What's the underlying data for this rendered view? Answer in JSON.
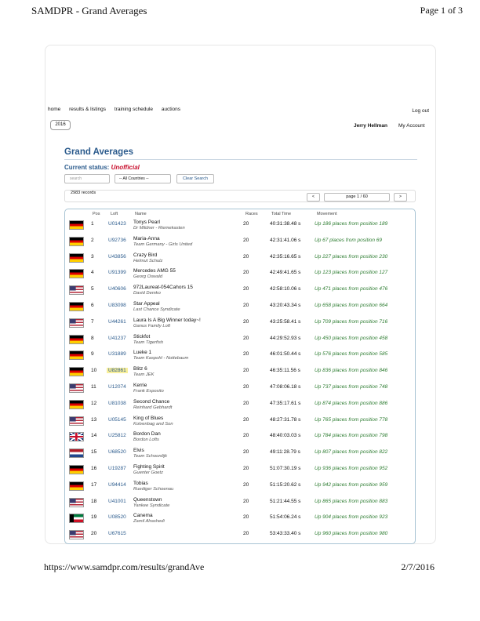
{
  "print": {
    "title": "SAMDPR - Grand Averages",
    "page": "Page 1 of 3",
    "url": "https://www.samdpr.com/results/grandAve",
    "date": "2/7/2016"
  },
  "nav": {
    "items": [
      "home",
      "results & listings",
      "training schedule",
      "auctions"
    ],
    "logout": "Log out"
  },
  "season": "2016",
  "user": {
    "name": "Jerry Hellman",
    "my_account": "My Account"
  },
  "page_title": "Grand Averages",
  "status": {
    "label": "Current status:",
    "value": "Unofficial"
  },
  "search": {
    "placeholder": "search"
  },
  "country_filter": {
    "selected": "-- All Countries --"
  },
  "clear_button": "Clear Search",
  "records": "2983 records",
  "pager": {
    "prev": "<",
    "page": "page 1 / 60",
    "next": ">"
  },
  "columns": [
    "Pos",
    "Loft",
    "Name",
    "Races",
    "Total Time",
    "Movement"
  ],
  "rows": [
    {
      "flag": "de",
      "pos": "1",
      "loft": "U01423",
      "name": "Tonys Pearl",
      "owner": "Dr Mildner - Riemekasten",
      "races": "20",
      "time": "40:31:38.48 s",
      "movement": "Up 186 places from position 189"
    },
    {
      "flag": "de",
      "pos": "2",
      "loft": "U92736",
      "name": "Maria-Anna",
      "owner": "Team Germany - Girls United",
      "races": "20",
      "time": "42:31:41.06 s",
      "movement": "Up 67 places from position 69"
    },
    {
      "flag": "de",
      "pos": "3",
      "loft": "U43856",
      "name": "Crazy Bird",
      "owner": "Helmut Schulz",
      "races": "20",
      "time": "42:35:16.65 s",
      "movement": "Up 227 places from position 230"
    },
    {
      "flag": "de",
      "pos": "4",
      "loft": "U91399",
      "name": "Mercedes AMG 55",
      "owner": "Georg Oswald",
      "races": "20",
      "time": "42:49:41.65 s",
      "movement": "Up 123 places from position 127"
    },
    {
      "flag": "us",
      "pos": "5",
      "loft": "U40606",
      "name": "972Laureat-054Cahors 15",
      "owner": "David Demko",
      "races": "20",
      "time": "42:58:10.06 s",
      "movement": "Up 471 places from position 476"
    },
    {
      "flag": "de",
      "pos": "6",
      "loft": "U83098",
      "name": "Star Appeal",
      "owner": "Last Chance Syndicate",
      "races": "20",
      "time": "43:20:43.34 s",
      "movement": "Up 658 places from position 664"
    },
    {
      "flag": "us",
      "pos": "7",
      "loft": "U44261",
      "name": "Laura Is A Big Winner today~!",
      "owner": "Ganus Family Loft",
      "races": "20",
      "time": "43:25:58.41 s",
      "movement": "Up 709 places from position 716"
    },
    {
      "flag": "de",
      "pos": "8",
      "loft": "U41237",
      "name": "Stickfot",
      "owner": "Team Tigerfish",
      "races": "20",
      "time": "44:29:52.93 s",
      "movement": "Up 450 places from position 458"
    },
    {
      "flag": "de",
      "pos": "9",
      "loft": "U31889",
      "name": "Lueke 1",
      "owner": "Team Kaspohl - Nottebaum",
      "races": "20",
      "time": "46:01:50.44 s",
      "movement": "Up 576 places from position 585"
    },
    {
      "flag": "de",
      "pos": "10",
      "loft": "U82861",
      "name": "Blitz 6",
      "owner": "Team JEK",
      "races": "20",
      "time": "46:35:11.56 s",
      "movement": "Up 836 places from position 846",
      "highlight": true
    },
    {
      "flag": "us",
      "pos": "11",
      "loft": "U12074",
      "name": "Kerrie",
      "owner": "Frank Esposito",
      "races": "20",
      "time": "47:08:06.18 s",
      "movement": "Up 737 places from position 748"
    },
    {
      "flag": "de",
      "pos": "12",
      "loft": "U81038",
      "name": "Second Chance",
      "owner": "Reinhard Gebhardt",
      "races": "20",
      "time": "47:35:17.61 s",
      "movement": "Up 874 places from position 886"
    },
    {
      "flag": "us",
      "pos": "13",
      "loft": "U05145",
      "name": "King of Blues",
      "owner": "Kolvenbag and Son",
      "races": "20",
      "time": "48:27:31.78 s",
      "movement": "Up 765 places from position 778"
    },
    {
      "flag": "gb",
      "pos": "14",
      "loft": "U25812",
      "name": "Bordon Dan",
      "owner": "Bordon Lofts",
      "races": "20",
      "time": "48:40:03.03 s",
      "movement": "Up 784 places from position 798"
    },
    {
      "flag": "nl",
      "pos": "15",
      "loft": "U68520",
      "name": "Elvis",
      "owner": "Team Schoordijk",
      "races": "20",
      "time": "49:11:28.79 s",
      "movement": "Up 807 places from position 822"
    },
    {
      "flag": "de",
      "pos": "16",
      "loft": "U19287",
      "name": "Fighting Spirit",
      "owner": "Guenter Goetz",
      "races": "20",
      "time": "51:07:30.19 s",
      "movement": "Up 936 places from position 952"
    },
    {
      "flag": "de",
      "pos": "17",
      "loft": "U94414",
      "name": "Tobias",
      "owner": "Ruediger Schoenau",
      "races": "20",
      "time": "51:15:20.62 s",
      "movement": "Up 942 places from position 959"
    },
    {
      "flag": "us",
      "pos": "18",
      "loft": "U41001",
      "name": "Queenstown",
      "owner": "Yankee Syndicate",
      "races": "20",
      "time": "51:21:44.55 s",
      "movement": "Up 865 places from position 883"
    },
    {
      "flag": "kw",
      "pos": "19",
      "loft": "U08520",
      "name": "Canema",
      "owner": "Zamil Alrashedi",
      "races": "20",
      "time": "51:54:06.24 s",
      "movement": "Up 904 places from position 923"
    },
    {
      "flag": "us",
      "pos": "20",
      "loft": "U67615",
      "name": "",
      "owner": "",
      "races": "20",
      "time": "53:43:33.40 s",
      "movement": "Up 960 places from position 980"
    }
  ]
}
